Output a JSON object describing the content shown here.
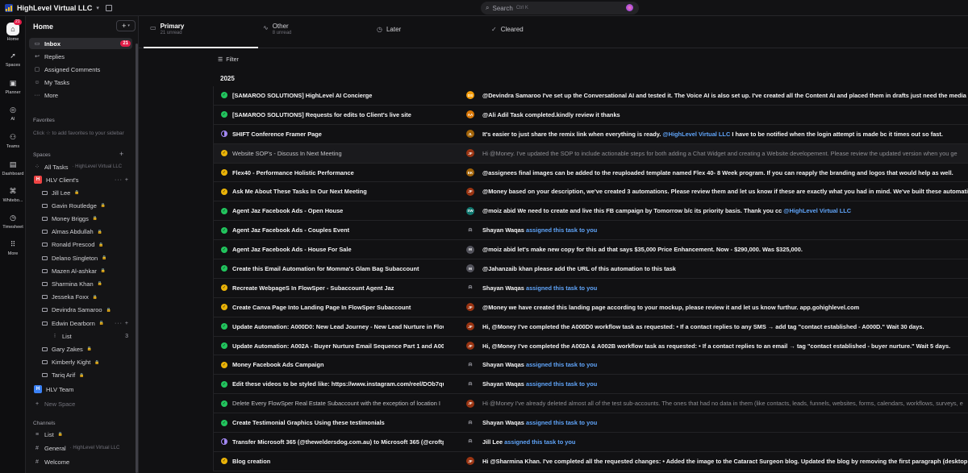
{
  "topbar": {
    "workspace_name": "HighLevel Virtual LLC",
    "search_placeholder": "Search",
    "search_shortcut": "Ctrl K"
  },
  "rail": {
    "items": [
      {
        "label": "Home",
        "badge": "21",
        "icon": "home-icon"
      },
      {
        "label": "Spaces",
        "icon": "rocket-icon"
      },
      {
        "label": "Planner",
        "icon": "planner-icon"
      },
      {
        "label": "AI",
        "icon": "ai-icon"
      },
      {
        "label": "Teams",
        "icon": "teams-icon"
      },
      {
        "label": "Dashboard",
        "icon": "dashboard-icon"
      },
      {
        "label": "Whitebo...",
        "icon": "whiteboard-icon"
      },
      {
        "label": "Timesheet",
        "icon": "clock-icon"
      },
      {
        "label": "More",
        "icon": "grid-icon"
      }
    ]
  },
  "sidebar": {
    "title": "Home",
    "nav": [
      {
        "label": "Inbox",
        "badge": "21",
        "active": true,
        "icon": "inbox-icon"
      },
      {
        "label": "Replies",
        "icon": "reply-icon"
      },
      {
        "label": "Assigned Comments",
        "icon": "comment-icon"
      },
      {
        "label": "My Tasks",
        "icon": "user-icon"
      },
      {
        "label": "More",
        "icon": "more-icon"
      }
    ],
    "favorites_label": "Favorites",
    "favorites_hint": "Click ☆ to add favorites to your sidebar",
    "spaces_label": "Spaces",
    "all_tasks": {
      "label": "All Tasks",
      "sub": "· HighLevel Virtual LLC"
    },
    "hlv_clients": {
      "label": "HLV Client's",
      "letter": "H",
      "color": "#ef4444"
    },
    "folders": [
      "Jill Lee",
      "Gavin Routledge",
      "Money Briggs",
      "Almas Abdullah",
      "Ronald Prescod",
      "Delano Singleton",
      "Mazen Al-ashkar",
      "Sharmina Khan",
      "Jesseka Foxx",
      "Devindra Samaroo",
      "Edwin Dearborn"
    ],
    "edwin_list": {
      "label": "List",
      "count": "3"
    },
    "folders_after": [
      "Gary Zakes",
      "Kimberly Kight",
      "Tariq Arif"
    ],
    "hlv_team": {
      "label": "HLV Team",
      "letter": "H",
      "color": "#3b82f6"
    },
    "new_space": "New Space",
    "channels_label": "Channels",
    "channels": [
      {
        "label": "List",
        "sub": ""
      },
      {
        "label": "General",
        "sub": "· HighLevel Virtual LLC"
      },
      {
        "label": "Welcome",
        "sub": ""
      }
    ]
  },
  "tabs": [
    {
      "label": "Primary",
      "sub": "21 unread",
      "active": true
    },
    {
      "label": "Other",
      "sub": "8 unread"
    },
    {
      "label": "Later",
      "sub": ""
    },
    {
      "label": "Cleared",
      "sub": ""
    }
  ],
  "filter_label": "Filter",
  "year_label": "2025",
  "status_colors": {
    "green": "#22c55e",
    "yellow": "#eab308",
    "purple": "#a78bfa"
  },
  "rows": [
    {
      "status": "green",
      "task": "[SAMAROO SOLUTIONS] HighLevel AI Concierge",
      "avatar": "DS",
      "avatar_color": "#f59e0b",
      "msg": "@Devindra Samaroo I've set up the Conversational AI and tested it. The Voice AI is also set up. I've created all the Content AI and placed them in drafts just need the media to",
      "link": "",
      "msg_after": "",
      "dim": false
    },
    {
      "status": "green",
      "task": "[SAMAROO SOLUTIONS] Requests for edits to Client's live site",
      "avatar": "AA",
      "avatar_color": "#d97706",
      "msg": "@Ali Adil Task completed.kindly review it thanks",
      "link": "",
      "msg_after": "",
      "dim": false
    },
    {
      "status": "purple",
      "task": "SHIFT Conference Framer Page",
      "avatar": "JL",
      "avatar_color": "#a16207",
      "msg": "It's easier to just share the remix link when everything is ready. ",
      "link": "@HighLevel Virtual LLC",
      "msg_after": " I have to be notified when the login attempt is made bc it times out so fast.",
      "dim": false
    },
    {
      "status": "yellow",
      "task": "Website SOP's - Discuss In Next Meeting",
      "avatar": "JF",
      "avatar_color": "#9a3412",
      "msg": "Hi @Money. I've updated the SOP to include actionable steps for both adding a Chat Widget and creating a Website developement. Please review the updated version when you ge",
      "link": "",
      "msg_after": "",
      "dim": true
    },
    {
      "status": "yellow",
      "task": "Flex40 - Performance Holistic Performance",
      "avatar": "EK",
      "avatar_color": "#a16207",
      "msg": "@assignees final images can be added to the reuploaded template named Flex 40- 8 Week program.  If you can reapply the branding and logos that would help as well.",
      "link": "",
      "msg_after": "",
      "dim": false
    },
    {
      "status": "yellow",
      "task": "Ask Me About These Tasks In Our Next Meeting",
      "avatar": "JF",
      "avatar_color": "#9a3412",
      "msg": "@Money based on your description, we've created 3 automations. Please review them and let us know if these are exactly what you had in mind. We've built these automatio",
      "link": "",
      "msg_after": "",
      "dim": false
    },
    {
      "status": "green",
      "task": "Agent Jaz Facebook Ads - Open House",
      "avatar": "SW",
      "avatar_color": "#0f766e",
      "msg": "@moiz abid We need to create and live this FB campaign by Tomorrow b/c its priority basis. Thank you cc ",
      "link": "@HighLevel Virtual LLC",
      "msg_after": "",
      "dim": false
    },
    {
      "status": "green",
      "task": "Agent Jaz Facebook Ads - Couples Event",
      "avatar": "bell",
      "avatar_color": "",
      "msg": "Shayan Waqas ",
      "link": "assigned this task to you",
      "msg_after": "",
      "dim": false
    },
    {
      "status": "green",
      "task": "Agent Jaz Facebook Ads - House For Sale",
      "avatar": "M",
      "avatar_color": "#52525b",
      "msg": "@moiz abid let's make new copy for this ad that says $35,000 Price Enhancement. Now - $290,000. Was $325,000.",
      "link": "",
      "msg_after": "",
      "dim": false
    },
    {
      "status": "green",
      "task": "Create this Email Automation for Momma's Glam Bag Subaccount",
      "avatar": "M",
      "avatar_color": "#52525b",
      "msg": "@Jahanzaib khan please add the URL of this automation to this task",
      "link": "",
      "msg_after": "",
      "dim": false
    },
    {
      "status": "yellow",
      "task": "Recreate WebpageS In FlowSper - Subaccount Agent Jaz",
      "avatar": "bell",
      "avatar_color": "",
      "msg": "Shayan Waqas ",
      "link": "assigned this task to you",
      "msg_after": "",
      "dim": false
    },
    {
      "status": "yellow",
      "task": "Create Canva Page Into Landing Page In FlowSper Subaccount",
      "avatar": "JF",
      "avatar_color": "#9a3412",
      "msg": "@Money we have created this landing page according to your mockup, please review it and let us know furthur. app.gohighlevel.com",
      "link": "",
      "msg_after": "",
      "dim": false
    },
    {
      "status": "green",
      "task": "Update Automation: A000D0: New Lead Journey - New Lead Nurture in Flow",
      "avatar": "JF",
      "avatar_color": "#9a3412",
      "msg": "Hi, @Money I've completed the A000D0 workflow task as requested: • If a contact replies to any SMS → add tag \"contact established - A000D.\" Wait 30 days.",
      "link": "",
      "msg_after": "",
      "dim": false
    },
    {
      "status": "green",
      "task": "Update Automation: A002A - Buyer Nurture Email Sequence Part 1 and A002",
      "avatar": "JF",
      "avatar_color": "#9a3412",
      "msg": "Hi, @Money I've completed the A002A & A002B workflow task as requested: • If a contact replies to an email → tag \"contact established - buyer nurture.\" Wait 5 days.",
      "link": "",
      "msg_after": "",
      "dim": false
    },
    {
      "status": "yellow",
      "task": "Money Facebook Ads Campaign",
      "avatar": "bell",
      "avatar_color": "",
      "msg": "Shayan Waqas ",
      "link": "assigned this task to you",
      "msg_after": "",
      "dim": false
    },
    {
      "status": "green",
      "task": "Edit these videos to be styled like: https://www.instagram.com/reel/DOb7qu",
      "avatar": "bell",
      "avatar_color": "",
      "msg": "Shayan Waqas ",
      "link": "assigned this task to you",
      "msg_after": "",
      "dim": false
    },
    {
      "status": "green",
      "task": "Delete Every FlowSper Real Estate Subaccount with the exception of location I",
      "avatar": "JF",
      "avatar_color": "#9a3412",
      "msg": "Hi @Money I've already deleted almost all of the test sub-accounts. The ones that had no data in them (like contacts, leads, funnels, websites, forms, calendars, workflows, surveys, e",
      "link": "",
      "msg_after": "",
      "dim": true
    },
    {
      "status": "green",
      "task": "Create Testimonial Graphics Using these testimonials",
      "avatar": "bell",
      "avatar_color": "",
      "msg": "Shayan Waqas ",
      "link": "assigned this task to you",
      "msg_after": "",
      "dim": false
    },
    {
      "status": "purple",
      "task": "Transfer Microsoft 365 (@theweldersdog.com.au) to Microsoft 365 (@croftp",
      "avatar": "bell",
      "avatar_color": "",
      "msg": "Jill Lee ",
      "link": "assigned this task to you",
      "msg_after": "",
      "dim": false
    },
    {
      "status": "yellow",
      "task": "Blog creation",
      "avatar": "JF",
      "avatar_color": "#9a3412",
      "msg": "Hi @Sharmina Khan. I've completed all the requested changes: • Added the image to the Cataract Surgeon blog. Updated the blog by removing the first paragraph (desktop",
      "link": "",
      "msg_after": "",
      "dim": false
    }
  ]
}
